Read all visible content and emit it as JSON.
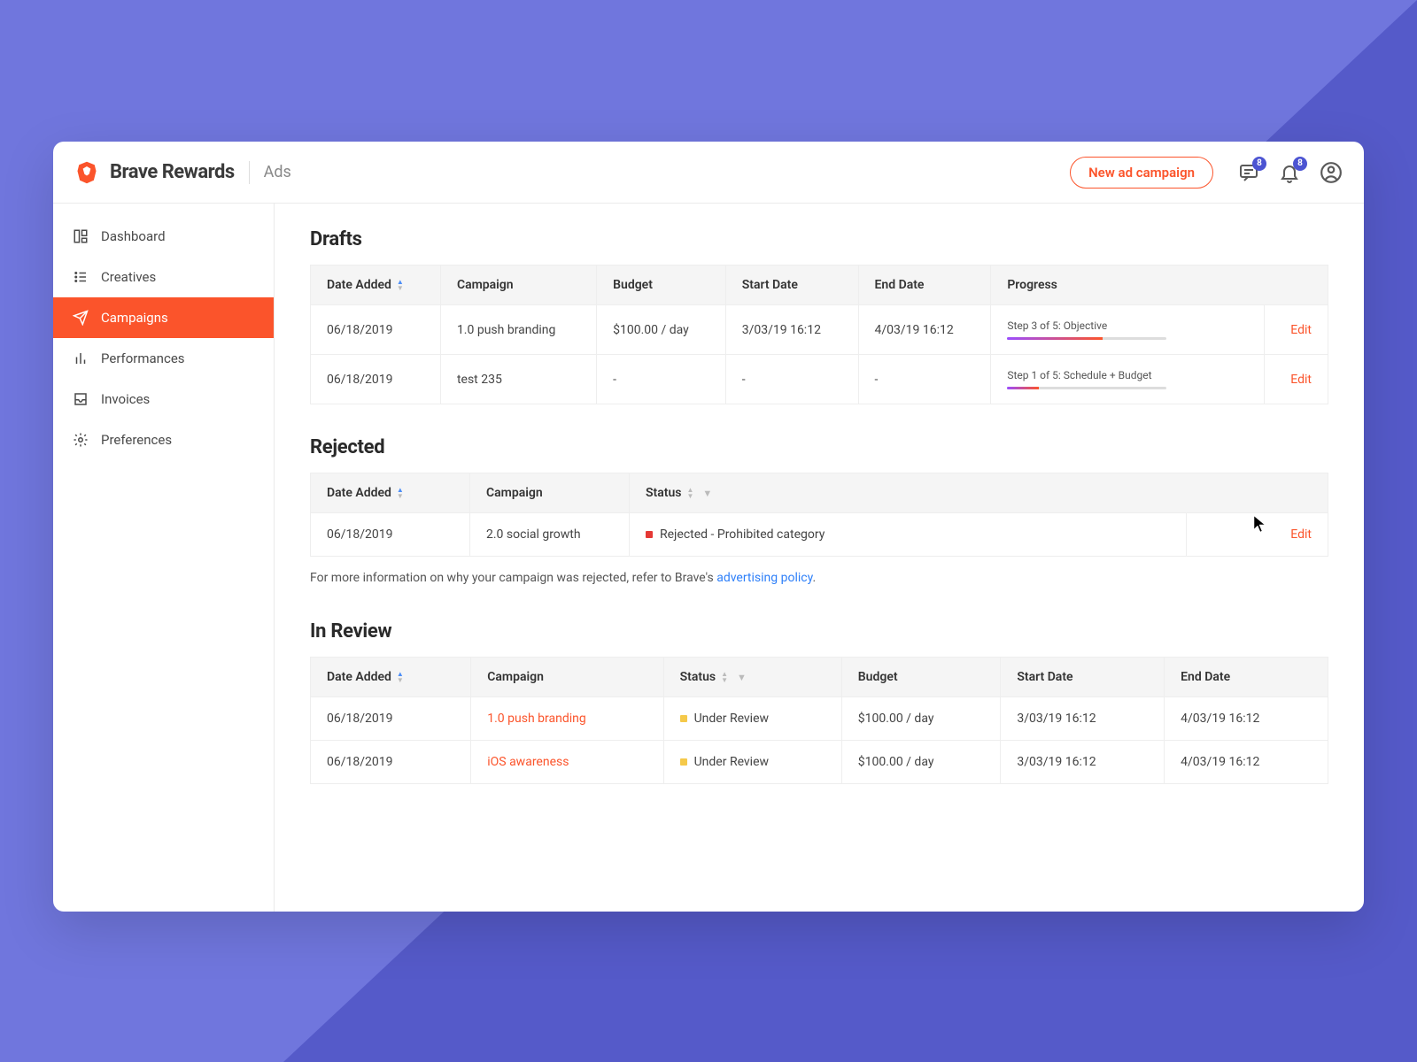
{
  "header": {
    "brand": "Brave Rewards",
    "section": "Ads",
    "new_campaign": "New ad campaign",
    "msg_badge": "8",
    "bell_badge": "8"
  },
  "sidebar": {
    "items": [
      {
        "label": "Dashboard"
      },
      {
        "label": "Creatives"
      },
      {
        "label": "Campaigns"
      },
      {
        "label": "Performances"
      },
      {
        "label": "Invoices"
      },
      {
        "label": "Preferences"
      }
    ]
  },
  "drafts": {
    "title": "Drafts",
    "cols": {
      "date": "Date Added",
      "campaign": "Campaign",
      "budget": "Budget",
      "start": "Start Date",
      "end": "End Date",
      "progress": "Progress"
    },
    "rows": [
      {
        "date": "06/18/2019",
        "campaign": "1.0 push branding",
        "budget": "$100.00 / day",
        "start": "3/03/19 16:12",
        "end": "4/03/19 16:12",
        "progress_label": "Step 3 of 5: Objective",
        "progress_pct": 60,
        "edit": "Edit"
      },
      {
        "date": "06/18/2019",
        "campaign": "test 235",
        "budget": "-",
        "start": "-",
        "end": "-",
        "progress_label": "Step 1 of 5: Schedule + Budget",
        "progress_pct": 20,
        "edit": "Edit"
      }
    ]
  },
  "rejected": {
    "title": "Rejected",
    "cols": {
      "date": "Date Added",
      "campaign": "Campaign",
      "status": "Status"
    },
    "rows": [
      {
        "date": "06/18/2019",
        "campaign": "2.0 social growth",
        "status": "Rejected - Prohibited category",
        "edit": "Edit"
      }
    ],
    "hint_pre": "For more information on why your campaign was rejected, refer to Brave's ",
    "hint_link": "advertising policy",
    "hint_post": "."
  },
  "inreview": {
    "title": "In Review",
    "cols": {
      "date": "Date Added",
      "campaign": "Campaign",
      "status": "Status",
      "budget": "Budget",
      "start": "Start Date",
      "end": "End Date"
    },
    "rows": [
      {
        "date": "06/18/2019",
        "campaign": "1.0 push branding",
        "status": "Under Review",
        "budget": "$100.00 / day",
        "start": "3/03/19 16:12",
        "end": "4/03/19 16:12"
      },
      {
        "date": "06/18/2019",
        "campaign": "iOS awareness",
        "status": "Under Review",
        "budget": "$100.00 / day",
        "start": "3/03/19 16:12",
        "end": "4/03/19 16:12"
      }
    ]
  }
}
